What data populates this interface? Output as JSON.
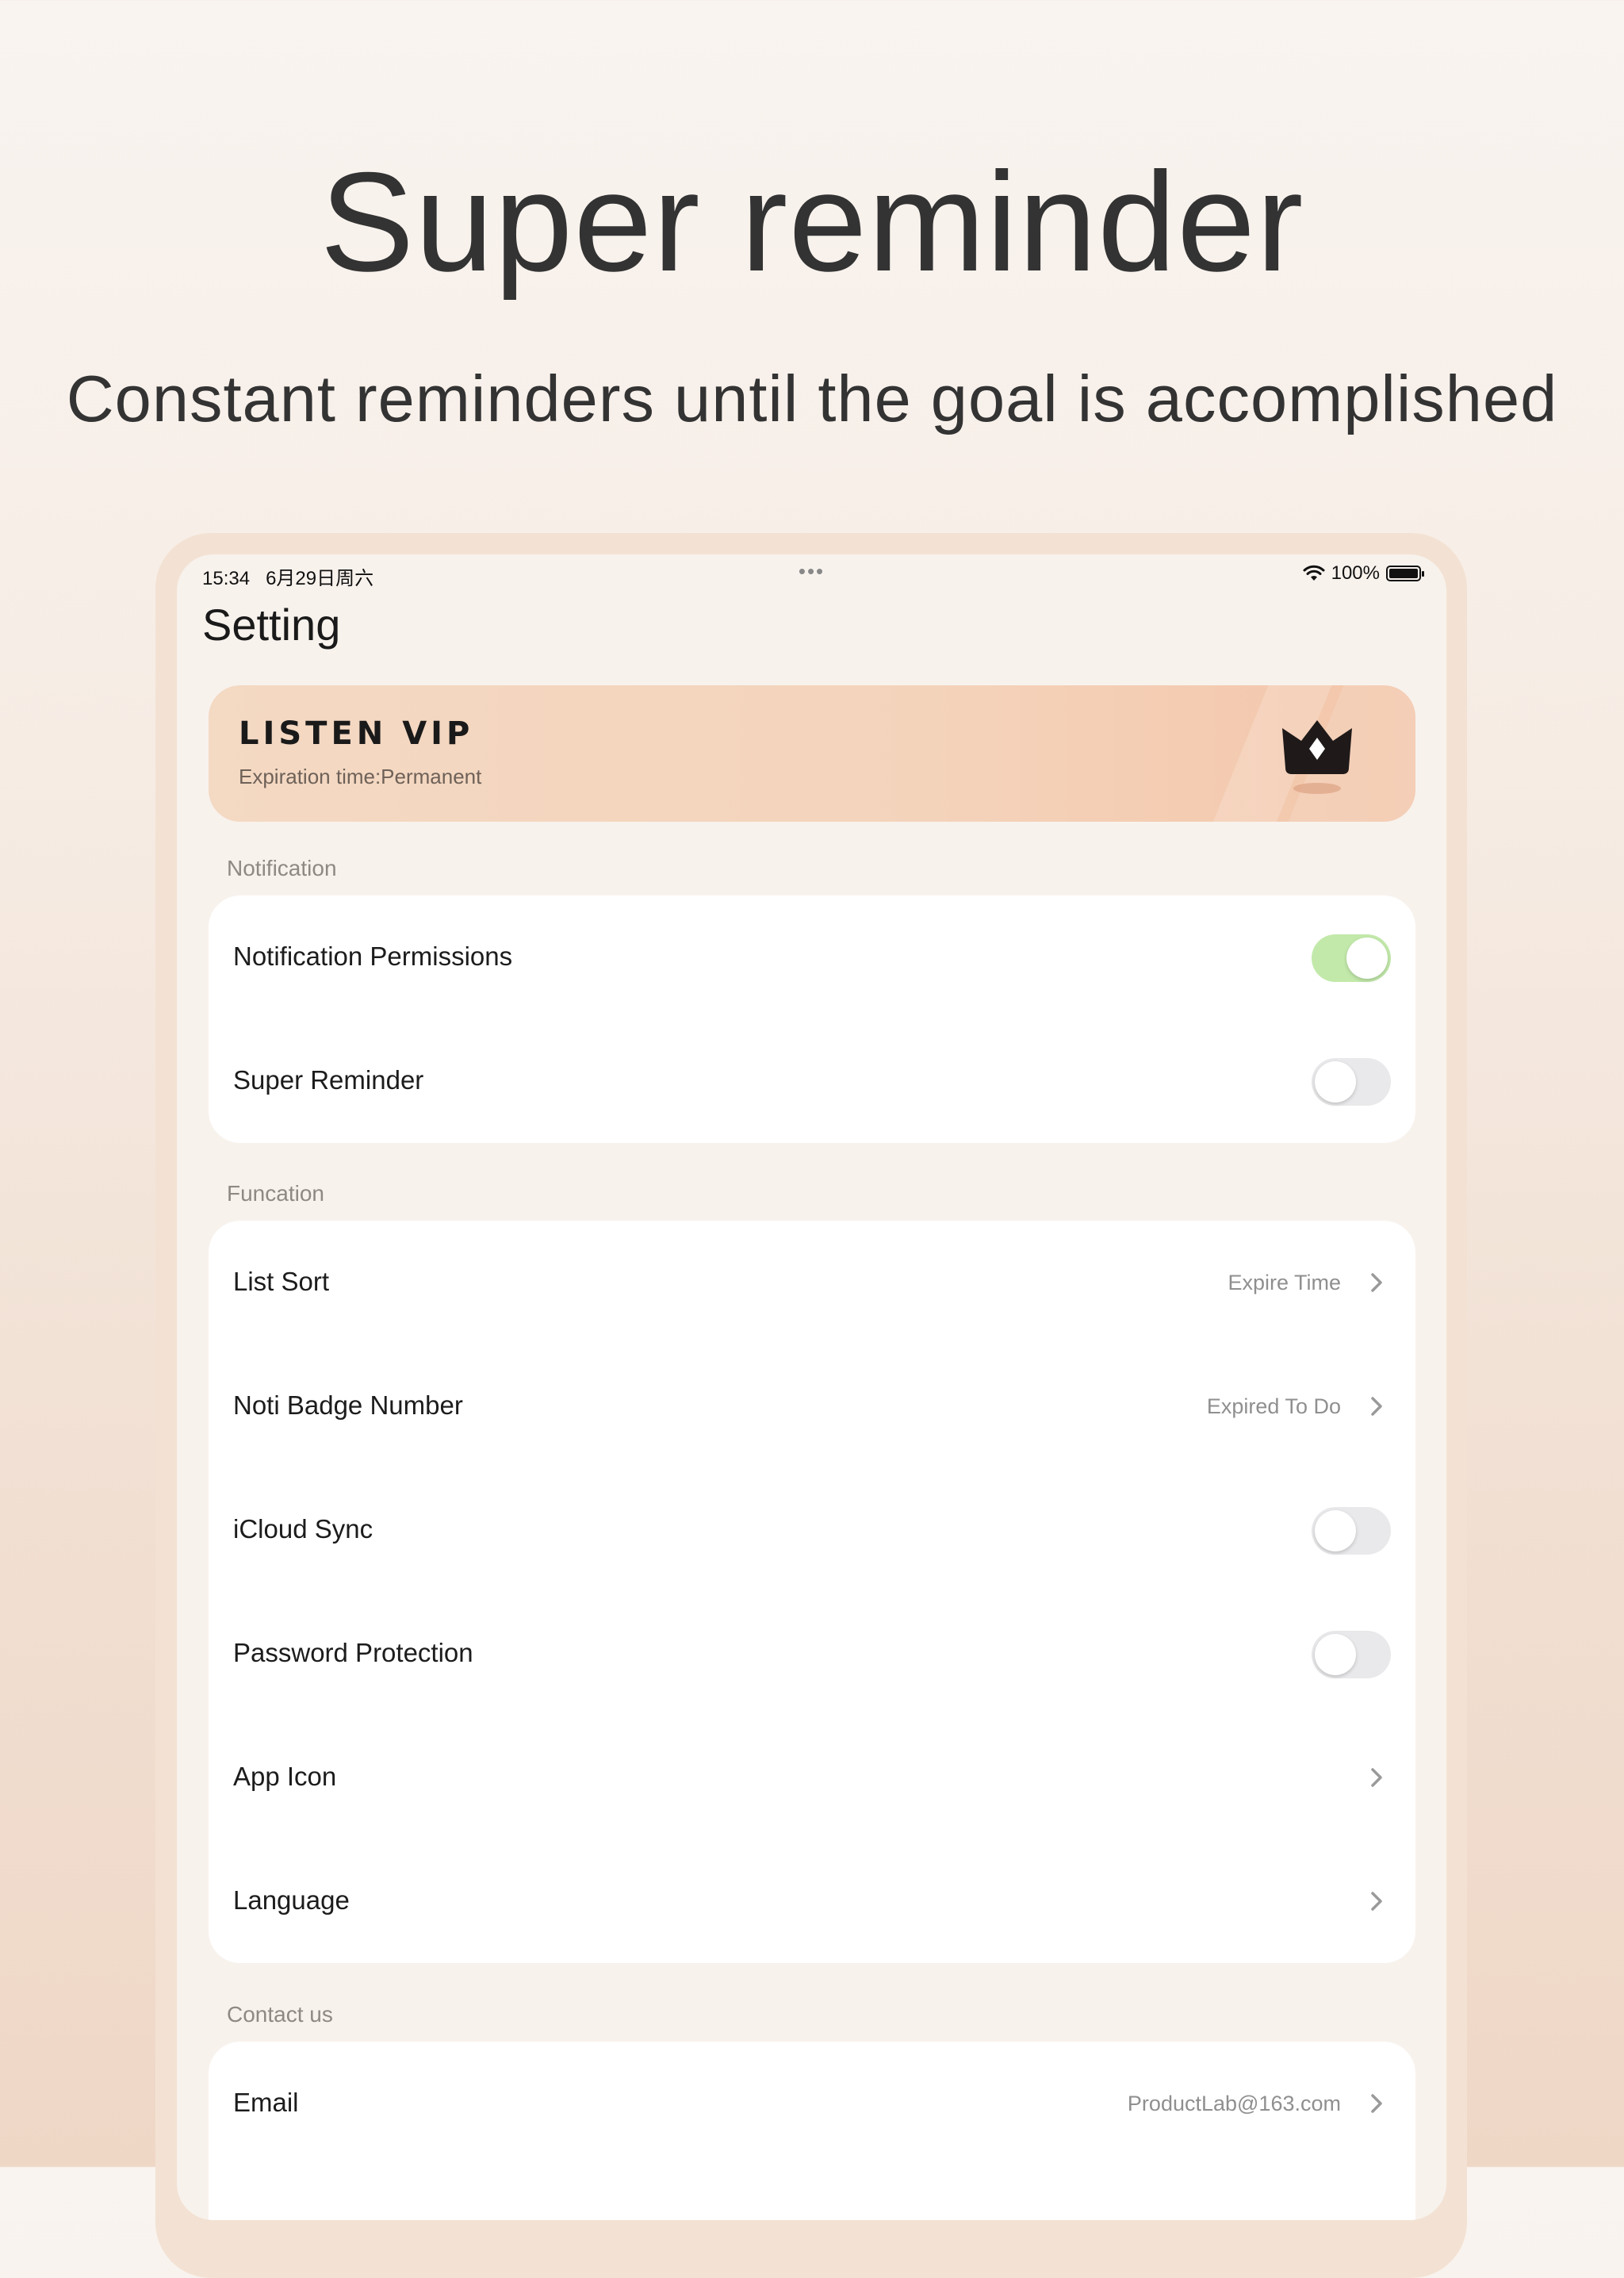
{
  "promo": {
    "headline": "Super reminder",
    "subline": "Constant reminders until the goal is accomplished"
  },
  "status_bar": {
    "time": "15:34",
    "date": "6月29日周六",
    "dots": "•••",
    "battery_text": "100%",
    "battery_level": 1.0
  },
  "page": {
    "title": "Setting"
  },
  "vip": {
    "title": "LISTEN VIP",
    "expiration": "Expiration time:Permanent",
    "icon": "crown-icon"
  },
  "sections": {
    "notification": {
      "label": "Notification",
      "rows": {
        "permissions": {
          "label": "Notification Permissions",
          "toggle_on": true
        },
        "super_reminder": {
          "label": "Super Reminder",
          "toggle_on": false
        }
      }
    },
    "function": {
      "label": "Funcation",
      "rows": {
        "list_sort": {
          "label": "List Sort",
          "value": "Expire Time"
        },
        "badge": {
          "label": "Noti Badge Number",
          "value": "Expired To Do"
        },
        "icloud": {
          "label": "iCloud Sync",
          "toggle_on": false
        },
        "password": {
          "label": "Password Protection",
          "toggle_on": false
        },
        "app_icon": {
          "label": "App Icon"
        },
        "language": {
          "label": "Language"
        }
      }
    },
    "contact": {
      "label": "Contact us",
      "rows": {
        "email": {
          "label": "Email",
          "value": "ProductLab@163.com"
        }
      }
    }
  },
  "colors": {
    "toggle_on": "#c2e9aa",
    "toggle_off": "#e9e9eb",
    "vip_card": "#f4d6bf"
  }
}
